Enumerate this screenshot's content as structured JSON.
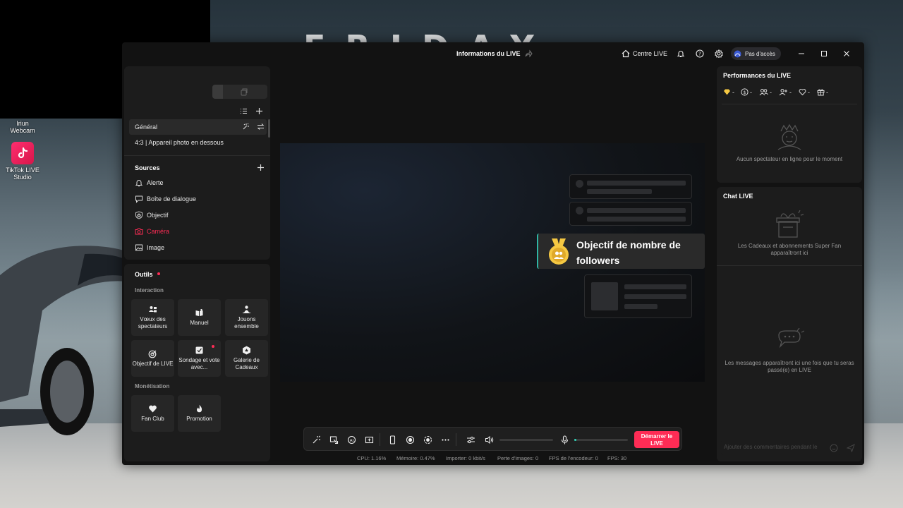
{
  "desktop": {
    "brand_letters": "FRIDAY",
    "webcam_label": "Iriun Webcam",
    "tiktok_label": "TikTok LIVE Studio"
  },
  "titlebar": {
    "title": "Informations du LIVE",
    "centre_live": "Centre LIVE",
    "access": "Pas d'accès"
  },
  "scenes": {
    "general": "Général",
    "layout": "4:3 | Appareil photo en dessous"
  },
  "sources": {
    "heading": "Sources",
    "items": [
      {
        "label": "Alerte",
        "icon": "bell-icon"
      },
      {
        "label": "Boîte de dialogue",
        "icon": "dialog-icon"
      },
      {
        "label": "Objectif",
        "icon": "shield-icon"
      },
      {
        "label": "Caméra",
        "icon": "camera-icon",
        "color": "#fe2c55"
      },
      {
        "label": "Image",
        "icon": "image-icon"
      }
    ]
  },
  "tools": {
    "heading": "Outils",
    "interaction_heading": "Interaction",
    "interaction": [
      {
        "label": "Vœux des spectateurs",
        "icon": "wishes-icon"
      },
      {
        "label": "Manuel",
        "icon": "book-icon"
      },
      {
        "label": "Jouons ensemble",
        "icon": "play-together-icon"
      },
      {
        "label": "Objectif de LIVE",
        "icon": "target-icon"
      },
      {
        "label": "Sondage et vote avec...",
        "icon": "poll-icon"
      },
      {
        "label": "Galerie de Cadeaux",
        "icon": "gift-gallery-icon"
      }
    ],
    "monetization_heading": "Monétisation",
    "monetization": [
      {
        "label": "Fan Club",
        "icon": "heart-icon"
      },
      {
        "label": "Promotion",
        "icon": "flame-icon"
      }
    ]
  },
  "preview": {
    "goal_text": "Objectif de nombre de followers"
  },
  "controls": {
    "start_button": "Démarrer le LIVE"
  },
  "stats": {
    "cpu": "CPU:  1.16%",
    "memory": "Mémoire:  0.47%",
    "import": "Importer:  0 kbit/s",
    "frame_loss": "Perte d'images:  0",
    "encoder_fps": "FPS de l'encodeur:  0",
    "fps": "FPS:  30"
  },
  "performance": {
    "heading": "Performances du LIVE",
    "metrics": [
      "-",
      "-",
      "-",
      "-",
      "-",
      "-"
    ],
    "empty": "Aucun spectateur en ligne pour le moment"
  },
  "chat": {
    "heading": "Chat LIVE",
    "gifts_empty": "Les Cadeaux et abonnements Super Fan apparaîtront ici",
    "messages_empty": "Les messages apparaîtront ici une fois que tu seras passé(e) en LIVE",
    "input_placeholder": "Ajouter des commentaires pendant le"
  },
  "colors": {
    "accent": "#fe2c55",
    "panel": "#1c1c1c",
    "window": "#121212",
    "goal_border": "#2fb5a4"
  }
}
